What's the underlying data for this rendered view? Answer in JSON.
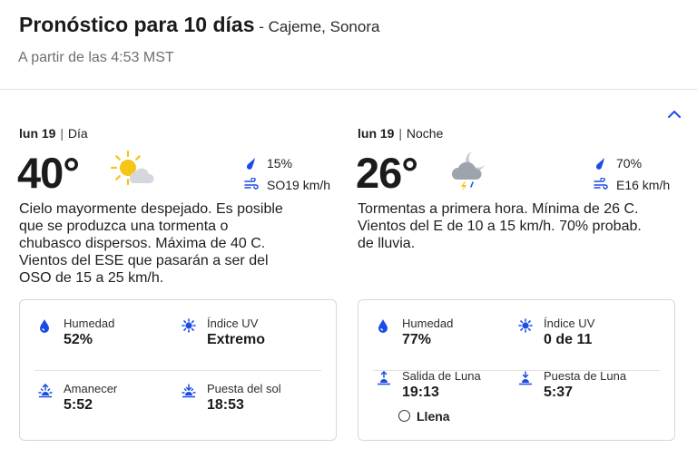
{
  "header": {
    "title": "Pronóstico para 10 días",
    "separator": " - ",
    "location": "Cajeme, Sonora",
    "as_of": "A partir de las 4:53 MST"
  },
  "day": {
    "date": "lun 19",
    "period": "Día",
    "temperature": "40°",
    "icon": "mostly-sunny-icon",
    "precip": "15%",
    "wind": "SO19 km/h",
    "description": "Cielo mayormente despejado. Es posible que se produzca una tormenta o chubasco dispersos. Máxima de 40 C. Vientos del ESE que pasarán a ser del OSO de 15 a 25 km/h.",
    "details": {
      "humidity_label": "Humedad",
      "humidity_value": "52%",
      "uv_label": "Índice UV",
      "uv_value": "Extremo",
      "sunrise_label": "Amanecer",
      "sunrise_value": "5:52",
      "sunset_label": "Puesta del sol",
      "sunset_value": "18:53"
    }
  },
  "night": {
    "date": "lun 19",
    "period": "Noche",
    "temperature": "26°",
    "icon": "night-thunderstorm-icon",
    "precip": "70%",
    "wind": "E16 km/h",
    "description": "Tormentas a primera hora. Mínima de 26 C. Vientos del E de 10 a 15 km/h. 70% probab. de lluvia.",
    "details": {
      "humidity_label": "Humedad",
      "humidity_value": "77%",
      "uv_label": "Índice UV",
      "uv_value": "0 de 11",
      "moonrise_label": "Salida de Luna",
      "moonrise_value": "19:13",
      "moonset_label": "Puesta de Luna",
      "moonset_value": "5:37",
      "moon_phase": "Llena"
    }
  },
  "colors": {
    "accent_blue": "#1b4de4",
    "text": "#1e1e1e",
    "sun_yellow": "#f5c518",
    "cloud_gray": "#c9ccd3"
  }
}
